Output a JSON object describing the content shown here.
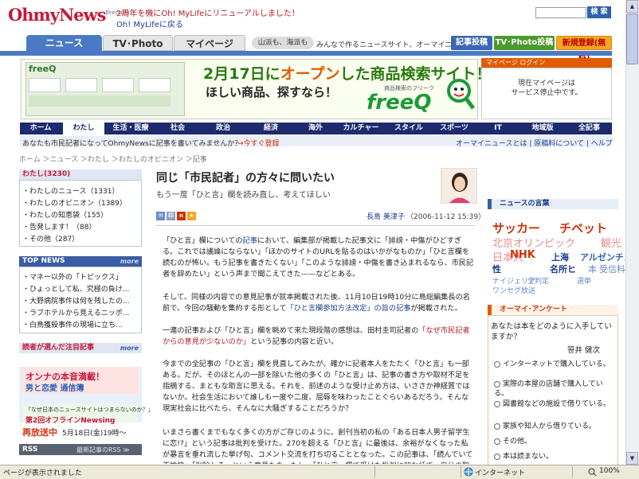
{
  "header": {
    "logo": "OhmyNews",
    "logo_sup": "βversion",
    "tagline1": "2周年を機にOh! MyLifeにリニューアルしました！",
    "tagline2": "Oh! MyLifeに戻る",
    "search_button": "検 索"
  },
  "top_tabs": {
    "news": "ニュース",
    "tv_photo": "TV･Photo",
    "mypage": "マイページ",
    "yama": "山派も、海派も",
    "desc": "みんなで作るニュースサイト、オーマイニュース",
    "post": "記事投稿",
    "tvphoto_post": "TV･Photo投稿",
    "register": "新規登録(無料)"
  },
  "ad": {
    "small_logo": "freeQ",
    "headline_prefix": "2月17日に",
    "headline_open": "オープン",
    "headline_suffix": "した商品検索サイト！",
    "sub_headline": "ほしい商品、探すなら！",
    "brand_sub": "商品検索のフリーク",
    "brand": "freeQ"
  },
  "mypage_login": {
    "title": "マイページ ログイン",
    "line1": "現在マイページは",
    "line2": "サービス停止中です。"
  },
  "nav": [
    "ホーム",
    "わたし",
    "生活・医療",
    "社会",
    "政治",
    "経済",
    "海外",
    "カルチャー",
    "スタイル",
    "スポーツ",
    "IT",
    "地域版",
    "全記事"
  ],
  "info_bar": {
    "prompt": "あなたも市民記者になってOhmyNewsに記事を書いてみませんか？",
    "register_link": "⇒今すぐ登録",
    "right_links": "オーマイニュースとは | 原稿料について | ヘルプ"
  },
  "breadcrumb": "ホーム ＞ニュース ＞わたし ＞わたしのオピニオン ＞記事",
  "left_sidebar": {
    "watashi_title": "わたし",
    "watashi_count": "(3230)",
    "watashi_items": [
      "・わたしのニュース（1331）",
      "・わたしのオピニオン（1389）",
      "・わたしの知恵袋（155）",
      "・告発します！（88）",
      "・その他（287）"
    ],
    "topnews_title": "TOP NEWS",
    "more": "more",
    "topnews_items": [
      "・マネー以外の「トピックス」",
      "・ひょっとして私、究極の負け...",
      "・大野病院事件は何を残したの...",
      "・ラブホテルから見えるニッポ...",
      "・白鳥獲殺事件の現場に立ち..."
    ],
    "ranking_title": "読者が選んだ注目記事",
    "banner1_line1": "オンナの本音満載！",
    "banner1_line2": "男と恋愛 通信簿",
    "banner2_line1": "「なぜ日本のニュースサイトはつまらないのか？」",
    "banner2_line2": "第2回オフラインNewsing",
    "rerun_label": "再放送中",
    "rerun_date": "5月18日(金)19時〜",
    "rss_label": "RSS",
    "rss_sub": "最新記事のRSS ≫"
  },
  "article": {
    "title": "同じ「市民記者」の方々に問いたい",
    "subtitle": "もう一度「ひと言」欄を読み直し、考えてほしい",
    "icon_mail": "✉",
    "icon_print": "印",
    "icon_n": "n",
    "icon_bm": "★",
    "author": "長島 美津子",
    "date": "（2006-11-12 15:39）",
    "p1a": "「ひと言」欄についての",
    "p1_link": "記事",
    "p1b": "において、編集部が掲載した記事文に「誹謗・中傷がひどすぎる。これでは議論にならない」「ほかのサイトのURLを貼るのはいかがなものか」「ひと言欄を読むのが怖い。もう記事を書きたくない」「このような誹謗・中傷を書き込まれるなら、市民記者を辞めたい」という声まで聞こえてきた——などとある。",
    "p2a": "そして、同様の内容での意見記事が就本掲載された後、11月10日19時10分に島総編集長の名前で、今回の騒動を集約する形として",
    "p2_link": "「ひと言欄参加方法改定」の旨の記事",
    "p2b": "が掲載された。",
    "p3a": "一連の記事および「ひと言」欄を眺めて来た現段階の感想は、田村圭司記者の",
    "p3_link": "「なぜ市民記者からの意見が少ないのか」",
    "p3b": "という記事の内容と近い。",
    "p4": "今までの全記事の「ひと言」欄を見直してみたが、確かに記者本人をたたく「ひと言」も一部ある。だが、そのほとんの一部を除いた他の多くの「ひと言」は、記事の書き方や取材不足を指摘する、まともな助言に思える。それを、前述のような受け止め方は、いささか神経質ではないか。社会生活において誰しも一度や二度、屈辱を味わったことぐらいあるだろう。そんな現実社会に比べたら、そんなに大騒ぎすることだろうか？",
    "p5": "いまさら書くまでもなく多くの方がご存じのように、創刊当初の私の「ある日本人男子留学生に恋!?」という記事は批判を受けた。270を超える「ひと言」に最後は、余裕がなくなった私が暴言を垂れ流した挙げ句、コメント交流を打ち切ることとなった。この記事は、「読んでいて不愉快」「削除しろ」という意見もあったし、「ひと言」欄で受けた批判に凹む話で、自分の取材力の浅さを知ることになった。"
  },
  "right_sidebar": {
    "words_title": "ニュースの言葉",
    "words": [
      "サッカー",
      "チベット",
      "北京オリンピック",
      "観光",
      "日本人",
      "NHK",
      "上海",
      "アルゼンチン",
      "性",
      "名所",
      "ヒ",
      "本",
      "受信料",
      "ナイジェリア",
      "全判定",
      "選挙",
      "ワンセグ放送"
    ],
    "survey_title": "オーマイ･アンケート",
    "survey_q": "あなたは本をどのように入手していますか？",
    "survey_author": "笹井 健次",
    "survey_options": [
      "インターネットで購入している。",
      "実際の本屋の店舗で購入している。",
      "図書館などの施設で借りている。",
      "家族や知人から借りている。",
      "その他。",
      "本は読まない。"
    ]
  },
  "status_bar": {
    "text": "ページが表示されました",
    "zone": "インターネット",
    "zoom": "100%"
  },
  "colors": {
    "brand": "#c41a3a",
    "nav_bg": "#1d2a6e",
    "tab_blue": "#4b7ac4",
    "orange": "#e05c00",
    "green_ad": "#2a7a10"
  }
}
